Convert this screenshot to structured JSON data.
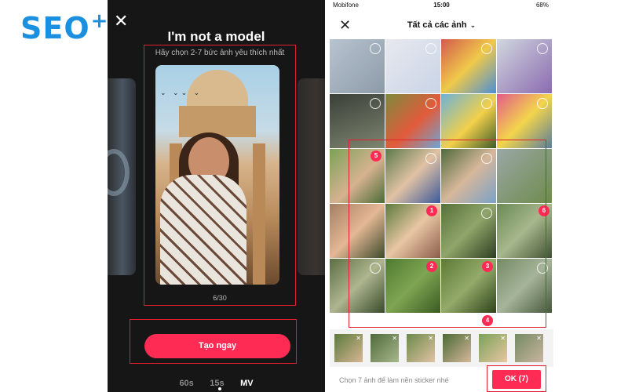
{
  "branding": {
    "logo_text": "SEO",
    "logo_plus": "+",
    "logo_color": "#1b8fe0"
  },
  "left_screen": {
    "title": "I'm not a model",
    "hint": "Hãy chọn 2-7 bức ảnh yêu thích nhất",
    "counter": "6/30",
    "create_button": "Tạo ngay",
    "tabs": [
      {
        "label": "60s",
        "active": false
      },
      {
        "label": "15s",
        "active": false
      },
      {
        "label": "MV",
        "active": true
      }
    ]
  },
  "right_screen": {
    "status": {
      "carrier": "Mobifone",
      "time": "15:00",
      "battery": "68%"
    },
    "title": "Tất cả các ảnh",
    "badges": [
      "5",
      "1",
      "2",
      "3",
      "4",
      "6"
    ],
    "footer_hint": "Chọn 7 ảnh để làm nền sticker nhé",
    "ok_button": "OK (7)"
  },
  "colors": {
    "accent": "#fe2c55",
    "highlight_box": "#e0202e",
    "dark_bg": "#161616"
  }
}
